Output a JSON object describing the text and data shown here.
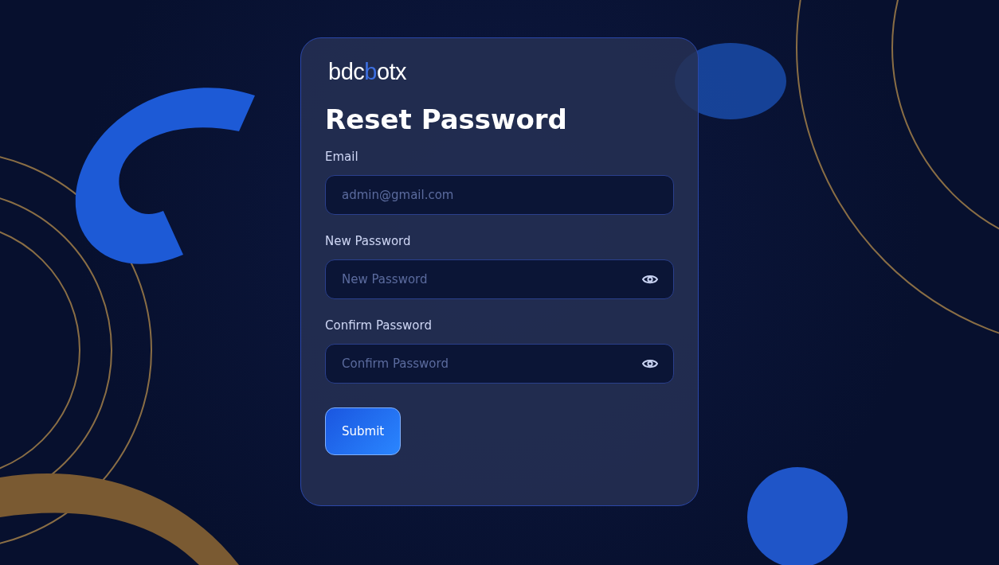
{
  "logo": {
    "lead": "bdc",
    "accent": "b",
    "tail": "otx"
  },
  "title": "Reset Password",
  "fields": [
    {
      "label": "Email",
      "placeholder": "admin@gmail.com",
      "kind": "text"
    },
    {
      "label": "New Password",
      "placeholder": "New Password",
      "kind": "password"
    },
    {
      "label": "Confirm Password",
      "placeholder": "Confirm Password",
      "kind": "password"
    }
  ],
  "submit": "Submit"
}
